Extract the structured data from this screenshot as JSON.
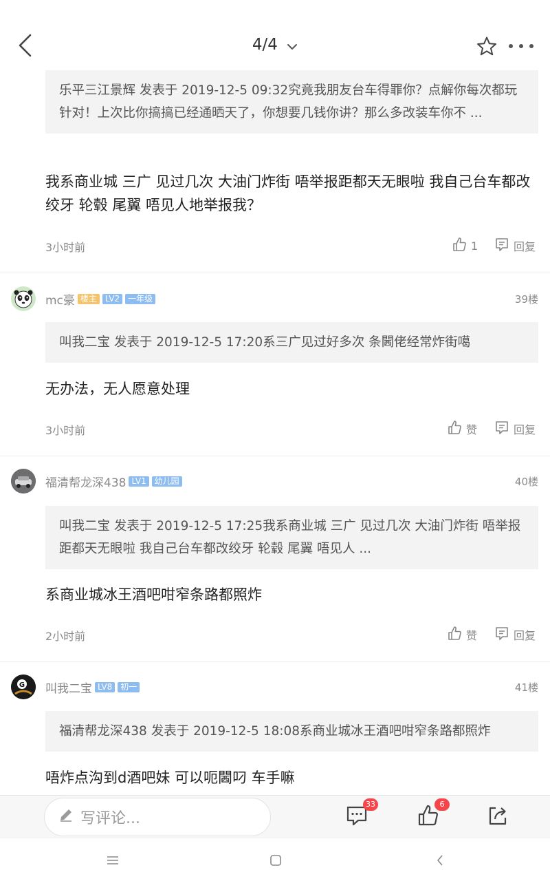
{
  "header": {
    "page_indicator": "4/4",
    "icons": [
      "back-arrow-icon",
      "chevron-down-icon",
      "star-icon",
      "more-icon"
    ]
  },
  "posts": [
    {
      "quote": "乐平三江景辉 发表于 2019-12-5 09:32究竟我朋友台车得罪你？点解你每次都玩针对！上次比你搞搞已经通晒天了，你想要几钱你讲？那么多改装车你不 ...",
      "reply": "我系商业城  三广 见过几次  大油门炸街  唔举报距都天无眼啦  我自己台车都改绞牙  轮毂  尾翼 唔见人地举报我？",
      "time": "3小时前",
      "like_label": "1",
      "reply_label": "回复"
    },
    {
      "username": "mc豪",
      "badges": [
        "楼主",
        "LV2",
        "一年级"
      ],
      "floor": "39楼",
      "quote": "叫我二宝 发表于 2019-12-5 17:20系三广见过好多次  条閪佬经常炸街噶",
      "reply": "无办法，无人愿意处理",
      "time": "3小时前",
      "like_label": "赞",
      "reply_label": "回复"
    },
    {
      "username": "福清帮龙深438",
      "badges": [
        "LV1",
        "幼儿园"
      ],
      "floor": "40楼",
      "quote": "叫我二宝 发表于 2019-12-5 17:25我系商业城  三广 见过几次  大油门炸街  唔举报距都天无眼啦  我自己台车都改绞牙  轮毂  尾翼 唔见人 ...",
      "reply": "系商业城冰王酒吧咁窄条路都照炸",
      "time": "2小时前",
      "like_label": "赞",
      "reply_label": "回复"
    },
    {
      "username": "叫我二宝",
      "badges": [
        "LV8",
        "初一"
      ],
      "floor": "41楼",
      "quote": "福清帮龙深438 发表于 2019-12-5 18:08系商业城冰王酒吧咁窄条路都照炸",
      "reply": "唔炸点沟到d酒吧妹  可以呃閪叼  车手嘛"
    }
  ],
  "bottom_bar": {
    "comment_placeholder": "写评论...",
    "comment_count": "33",
    "like_count": "6",
    "icons": [
      "pencil-icon",
      "comment-icon",
      "thumbs-up-icon",
      "share-icon"
    ]
  },
  "system_nav": {
    "icons": [
      "menu-icon",
      "home-square-icon",
      "back-triangle-icon"
    ]
  },
  "colors": {
    "badge_owner": "#f5c36a",
    "badge_level": "#8cbcf0",
    "count_badge": "#f4464b",
    "quote_bg": "#f3f3f4"
  }
}
